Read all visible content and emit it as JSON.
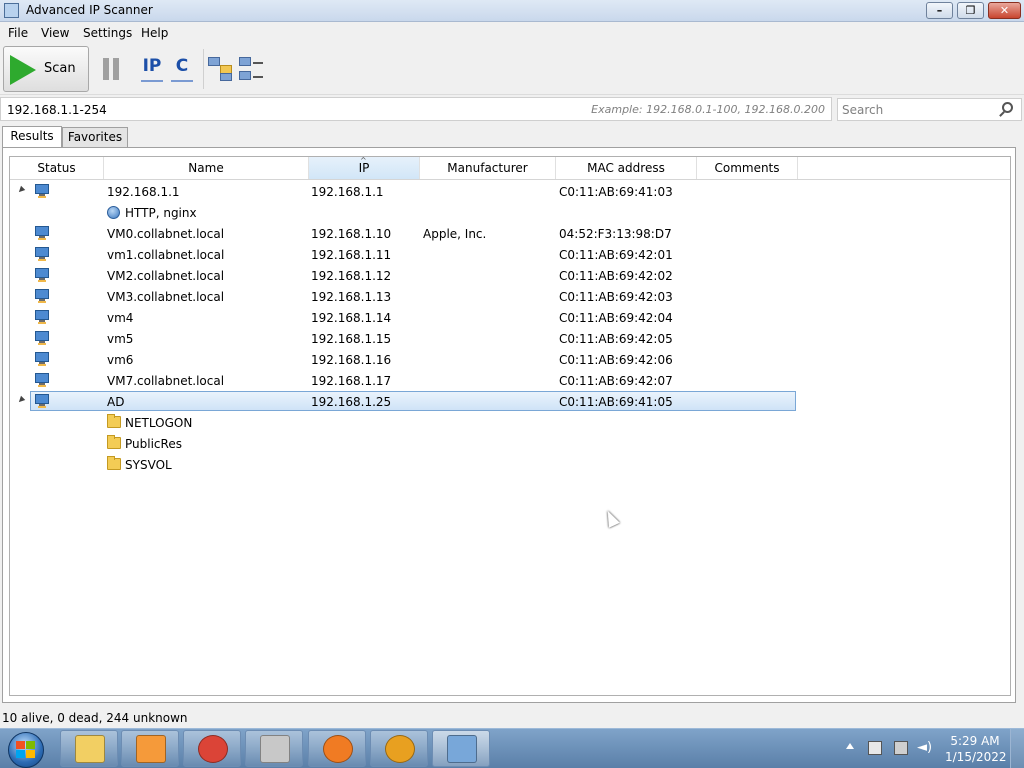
{
  "window": {
    "title": "Advanced IP Scanner"
  },
  "menu": [
    "File",
    "View",
    "Settings",
    "Help"
  ],
  "toolbar": {
    "scan_label": "Scan",
    "ip_label": "IP",
    "c_label": "C"
  },
  "address": {
    "range": "192.168.1.1-254",
    "example": "Example: 192.168.0.1-100, 192.168.0.200"
  },
  "search": {
    "placeholder": "Search"
  },
  "tabs": [
    "Results",
    "Favorites"
  ],
  "columns": [
    "Status",
    "Name",
    "IP",
    "Manufacturer",
    "MAC address",
    "Comments"
  ],
  "sorted_column": "IP",
  "rows": [
    {
      "kind": "host",
      "expanded": true,
      "name": "192.168.1.1",
      "ip": "192.168.1.1",
      "manufacturer": "",
      "mac": "C0:11:AB:69:41:03"
    },
    {
      "kind": "service",
      "icon": "globe-icon",
      "name": "HTTP, nginx"
    },
    {
      "kind": "host",
      "name": "VM0.collabnet.local",
      "ip": "192.168.1.10",
      "manufacturer": "Apple, Inc.",
      "mac": "04:52:F3:13:98:D7"
    },
    {
      "kind": "host",
      "name": "vm1.collabnet.local",
      "ip": "192.168.1.11",
      "manufacturer": "",
      "mac": "C0:11:AB:69:42:01"
    },
    {
      "kind": "host",
      "name": "VM2.collabnet.local",
      "ip": "192.168.1.12",
      "manufacturer": "",
      "mac": "C0:11:AB:69:42:02"
    },
    {
      "kind": "host",
      "name": "VM3.collabnet.local",
      "ip": "192.168.1.13",
      "manufacturer": "",
      "mac": "C0:11:AB:69:42:03"
    },
    {
      "kind": "host",
      "name": "vm4",
      "ip": "192.168.1.14",
      "manufacturer": "",
      "mac": "C0:11:AB:69:42:04"
    },
    {
      "kind": "host",
      "name": "vm5",
      "ip": "192.168.1.15",
      "manufacturer": "",
      "mac": "C0:11:AB:69:42:05"
    },
    {
      "kind": "host",
      "name": "vm6",
      "ip": "192.168.1.16",
      "manufacturer": "",
      "mac": "C0:11:AB:69:42:06"
    },
    {
      "kind": "host",
      "name": "VM7.collabnet.local",
      "ip": "192.168.1.17",
      "manufacturer": "",
      "mac": "C0:11:AB:69:42:07"
    },
    {
      "kind": "host",
      "expanded": true,
      "selected": true,
      "name": "AD",
      "ip": "192.168.1.25",
      "manufacturer": "",
      "mac": "C0:11:AB:69:41:05"
    },
    {
      "kind": "share",
      "icon": "folder-icon",
      "name": "NETLOGON"
    },
    {
      "kind": "share",
      "icon": "folder-icon",
      "name": "PublicRes"
    },
    {
      "kind": "share",
      "icon": "folder-icon",
      "name": "SYSVOL"
    }
  ],
  "status": "10 alive, 0 dead, 244 unknown",
  "taskbar": {
    "apps": [
      "file-explorer-icon",
      "media-player-icon",
      "chrome-icon",
      "app-icon",
      "avast-icon",
      "vpn-icon",
      "ip-scanner-icon"
    ],
    "time": "5:29 AM",
    "date": "1/15/2022"
  },
  "colors": {
    "selection": "#cfe3f7",
    "scan_green": "#2eaa2e",
    "link_blue": "#1c4fa8"
  }
}
